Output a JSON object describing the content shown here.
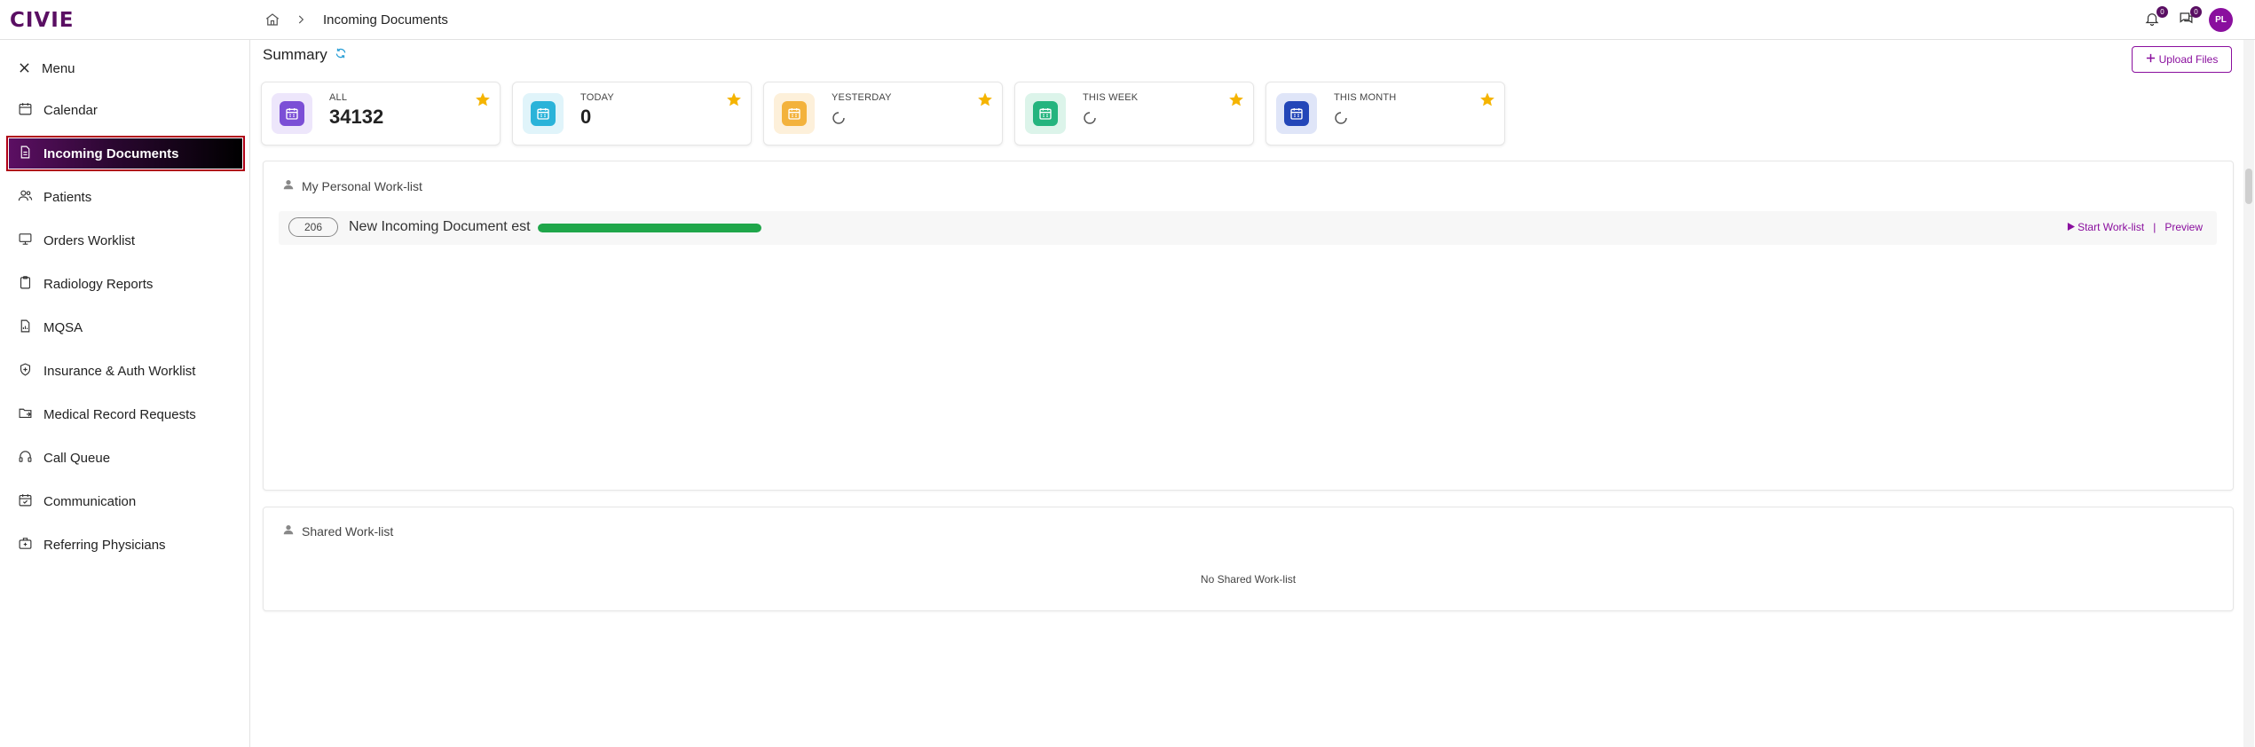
{
  "app": {
    "logo": "CIVIE",
    "avatar_initials": "PL",
    "notifications_count": "0",
    "messages_count": "0"
  },
  "breadcrumb": {
    "current": "Incoming Documents"
  },
  "sidebar": {
    "menu_label": "Menu",
    "items": [
      {
        "label": "Calendar",
        "icon": "calendar-icon"
      },
      {
        "label": "Incoming Documents",
        "icon": "document-icon",
        "active": true
      },
      {
        "label": "Patients",
        "icon": "users-icon"
      },
      {
        "label": "Orders Worklist",
        "icon": "monitor-icon"
      },
      {
        "label": "Radiology Reports",
        "icon": "clipboard-icon"
      },
      {
        "label": "MQSA",
        "icon": "file-chart-icon"
      },
      {
        "label": "Insurance & Auth Worklist",
        "icon": "shield-icon"
      },
      {
        "label": "Medical Record Requests",
        "icon": "folder-send-icon"
      },
      {
        "label": "Call Queue",
        "icon": "headset-icon"
      },
      {
        "label": "Communication",
        "icon": "calendar-check-icon"
      },
      {
        "label": "Referring Physicians",
        "icon": "medical-case-icon"
      }
    ]
  },
  "summary": {
    "title": "Summary",
    "upload_label": "Upload Files",
    "cards": [
      {
        "label": "ALL",
        "value": "34132",
        "accent": "#7b4fd6",
        "bg": "#ede6fb"
      },
      {
        "label": "TODAY",
        "value": "0",
        "accent": "#2ab3d9",
        "bg": "#e0f4fa"
      },
      {
        "label": "YESTERDAY",
        "value": "",
        "accent": "#f3b23c",
        "bg": "#fdf0da"
      },
      {
        "label": "THIS WEEK",
        "value": "",
        "accent": "#24b47e",
        "bg": "#dcf4ea"
      },
      {
        "label": "THIS MONTH",
        "value": "",
        "accent": "#2346b8",
        "bg": "#dfe5f8"
      }
    ]
  },
  "personal_worklist": {
    "title": "My Personal Work-list",
    "items": [
      {
        "count": "206",
        "name": "New Incoming Document est",
        "progress": 1.0
      }
    ],
    "start_label": "Start Work-list",
    "separator": "|",
    "preview_label": "Preview"
  },
  "shared_worklist": {
    "title": "Shared Work-list",
    "empty_text": "No Shared Work-list"
  },
  "colors": {
    "brand": "#5a0f63",
    "accent": "#8a0f9e",
    "progress": "#1fa64a",
    "star": "#f5b400"
  }
}
